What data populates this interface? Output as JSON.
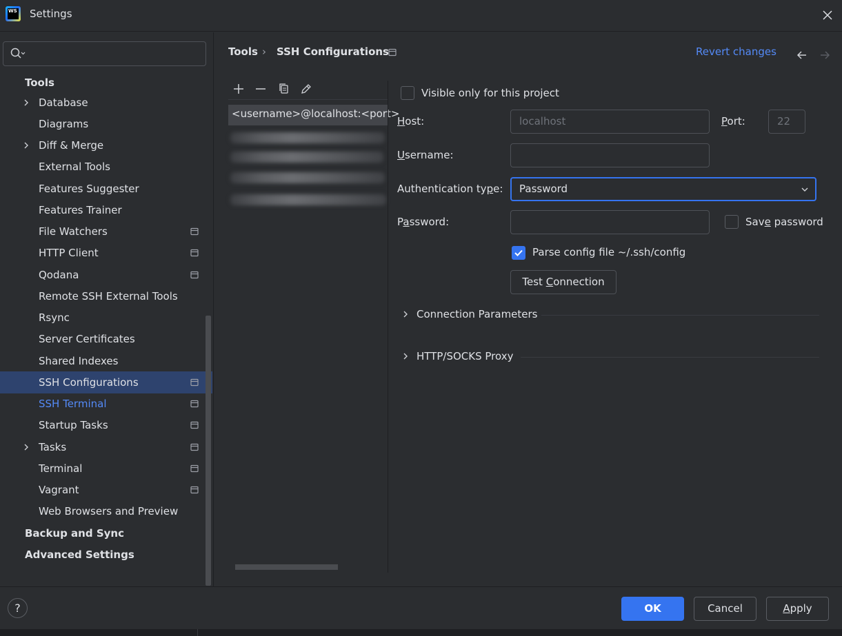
{
  "window": {
    "title": "Settings",
    "logo_text": "WS"
  },
  "search": {
    "placeholder": ""
  },
  "sidebar": {
    "items": [
      {
        "label": "Tools",
        "bold": true
      },
      {
        "label": "Database",
        "expandable": true
      },
      {
        "label": "Diagrams"
      },
      {
        "label": "Diff & Merge",
        "expandable": true
      },
      {
        "label": "External Tools"
      },
      {
        "label": "Features Suggester"
      },
      {
        "label": "Features Trainer"
      },
      {
        "label": "File Watchers",
        "project_icon": true
      },
      {
        "label": "HTTP Client",
        "project_icon": true
      },
      {
        "label": "Qodana",
        "project_icon": true
      },
      {
        "label": "Remote SSH External Tools"
      },
      {
        "label": "Rsync"
      },
      {
        "label": "Server Certificates"
      },
      {
        "label": "Shared Indexes"
      },
      {
        "label": "SSH Configurations",
        "project_icon": true,
        "selected": true
      },
      {
        "label": "SSH Terminal",
        "project_icon": true,
        "link": true
      },
      {
        "label": "Startup Tasks",
        "project_icon": true
      },
      {
        "label": "Tasks",
        "expandable": true,
        "project_icon": true
      },
      {
        "label": "Terminal",
        "project_icon": true
      },
      {
        "label": "Vagrant",
        "project_icon": true
      },
      {
        "label": "Web Browsers and Preview"
      },
      {
        "label": "Backup and Sync",
        "bold": true
      },
      {
        "label": "Advanced Settings",
        "bold": true
      }
    ]
  },
  "header": {
    "breadcrumb_root": "Tools",
    "breadcrumb_separator": "›",
    "breadcrumb_current": "SSH Configurations",
    "revert_label": "Revert changes"
  },
  "host_list": {
    "selected_host": "<username>@localhost:<port>"
  },
  "form": {
    "visible_only_label": "Visible only for this project",
    "host_label_u": "H",
    "host_label_rest": "ost:",
    "host_placeholder": "localhost",
    "port_label_u": "P",
    "port_label_rest": "ort:",
    "port_placeholder": "22",
    "username_label_u": "U",
    "username_label_rest": "sername:",
    "username_value": "",
    "auth_label_pre": "Authentication ty",
    "auth_label_u": "p",
    "auth_label_post": "e:",
    "auth_value": "Password",
    "password_label_pre": "P",
    "password_label_u": "a",
    "password_label_post": "ssword:",
    "password_value": "",
    "save_password_pre": "Sav",
    "save_password_u": "e",
    "save_password_post": " password",
    "parse_config_label": "Parse config file ~/.ssh/config",
    "test_conn_pre": "Test ",
    "test_conn_u": "C",
    "test_conn_post": "onnection",
    "connection_params": "Connection Parameters",
    "proxy": "HTTP/SOCKS Proxy"
  },
  "footer": {
    "help": "?",
    "ok": "OK",
    "cancel": "Cancel",
    "apply_u": "A",
    "apply_rest": "pply"
  },
  "colors": {
    "background": "#2b2d30",
    "accent": "#3574f0",
    "link": "#548af7",
    "selection": "#2e436e"
  }
}
